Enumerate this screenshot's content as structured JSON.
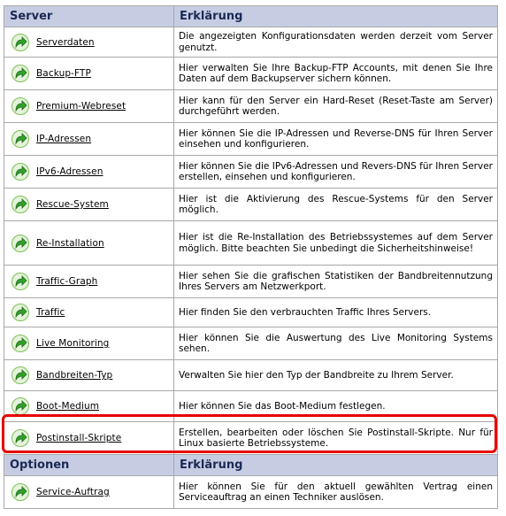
{
  "server_section": {
    "header_left": "Server",
    "header_right": "Erklärung",
    "rows": [
      {
        "label": "Serverdaten",
        "desc": "Die angezeigten Konfigurationsdaten werden derzeit vom Server genutzt."
      },
      {
        "label": "Backup-FTP",
        "desc": "Hier verwalten Sie Ihre Backup-FTP Accounts, mit denen Sie Ihre Daten auf dem Backupserver sichern können."
      },
      {
        "label": "Premium-Webreset",
        "desc": "Hier kann für den Server ein Hard-Reset (Reset-Taste am Server) durchgeführt werden."
      },
      {
        "label": "IP-Adressen",
        "desc": "Hier können Sie die IP-Adressen und Reverse-DNS für Ihren Server einsehen und konfigurieren."
      },
      {
        "label": "IPv6-Adressen",
        "desc": "Hier können Sie die IPv6-Adressen und Revers-DNS für Ihren Server erstellen, einsehen und konfigurieren."
      },
      {
        "label": "Rescue-System",
        "desc": "Hier ist die Aktivierung des Rescue-Systems für den Server möglich."
      },
      {
        "label": "Re-Installation",
        "desc": "Hier ist die Re-Installation des Betriebssystemes auf dem Server möglich. Bitte beachten Sie unbedingt die Sicherheitshinweise!"
      },
      {
        "label": "Traffic-Graph",
        "desc": "Hier sehen Sie die grafischen Statistiken der Bandbreitennutzung Ihres Servers am Netzwerkport."
      },
      {
        "label": "Traffic",
        "desc": "Hier finden Sie den verbrauchten Traffic Ihres Servers."
      },
      {
        "label": "Live Monitoring",
        "desc": "Hier können Sie die Auswertung des Live Monitoring Systems sehen."
      },
      {
        "label": "Bandbreiten-Typ",
        "desc": "Verwalten Sie hier den Typ der Bandbreite zu Ihrem Server."
      },
      {
        "label": "Boot-Medium",
        "desc": "Hier können Sie das Boot-Medium festlegen."
      },
      {
        "label": "Postinstall-Skripte",
        "desc": "Erstellen, bearbeiten oder löschen Sie Postinstall-Skripte. Nur für Linux basierte Betriebssysteme."
      }
    ]
  },
  "options_section": {
    "header_left": "Optionen",
    "header_right": "Erklärung",
    "rows": [
      {
        "label": "Service-Auftrag",
        "desc": "Hier können Sie für den aktuell gewählten Vertrag einen Serviceauftrag an einen Techniker auslösen."
      }
    ]
  },
  "row_icon": "green-arrow-icon",
  "colors": {
    "header_bg": "#c6cde3",
    "highlight": "#e60000",
    "border": "#a8a8a8"
  }
}
